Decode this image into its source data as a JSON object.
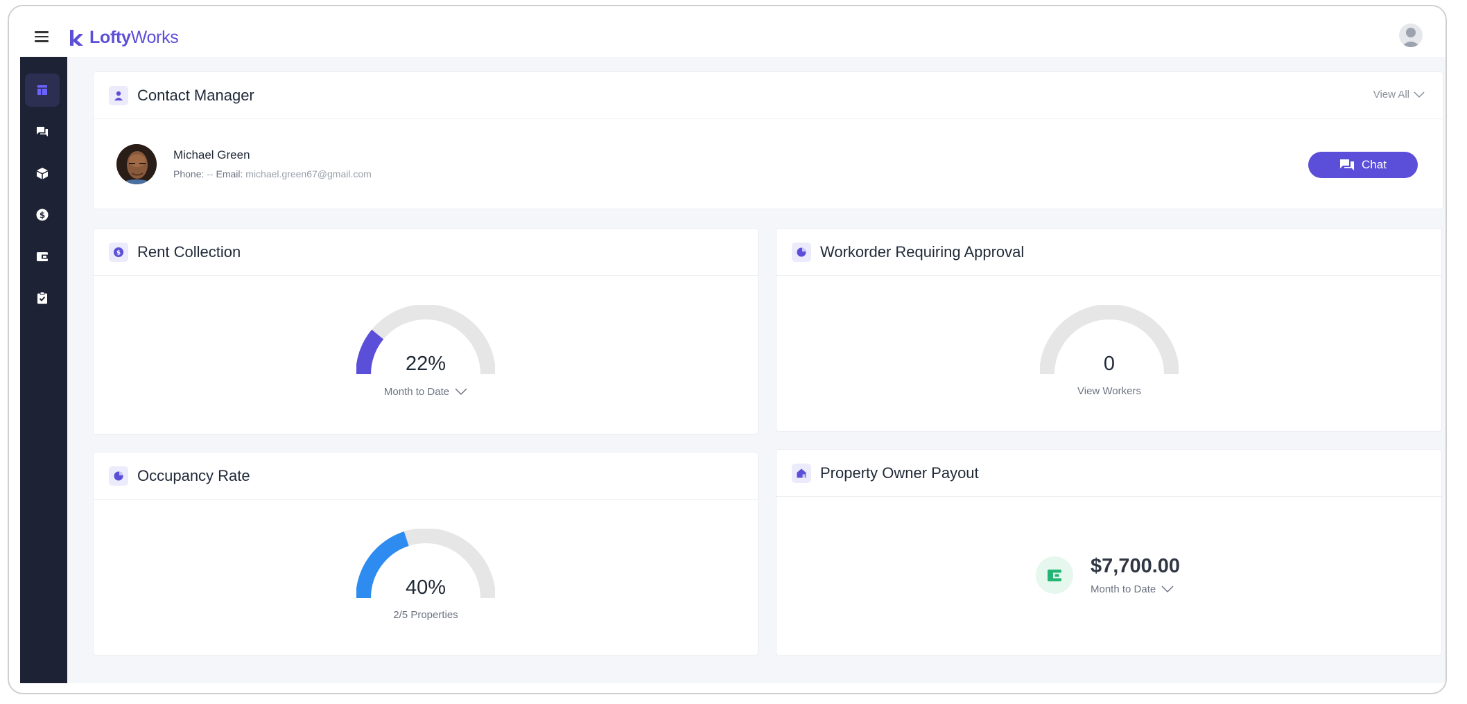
{
  "app": {
    "logo_bold": "Lofty",
    "logo_light": "Works"
  },
  "sidebar": {
    "items": [
      {
        "icon": "dashboard-icon",
        "active": true
      },
      {
        "icon": "chat-icon",
        "active": false
      },
      {
        "icon": "box-icon",
        "active": false
      },
      {
        "icon": "dollar-icon",
        "active": false
      },
      {
        "icon": "wallet-icon",
        "active": false
      },
      {
        "icon": "clipboard-check-icon",
        "active": false
      }
    ]
  },
  "contact_manager": {
    "title": "Contact Manager",
    "view_all": "View All",
    "name": "Michael Green",
    "phone_label": "Phone:",
    "phone_value": "--",
    "email_label": "Email:",
    "email_value": "michael.green67@gmail.com",
    "chat_label": "Chat"
  },
  "rent_collection": {
    "title": "Rent Collection",
    "value": "22%",
    "percent": 22,
    "period": "Month to Date",
    "color": "#5b4ed8"
  },
  "workorder": {
    "title": "Workorder Requiring Approval",
    "value": "0",
    "percent": 0,
    "link": "View Workers"
  },
  "occupancy": {
    "title": "Occupancy Rate",
    "value": "40%",
    "percent": 40,
    "sub": "2/5 Properties",
    "color": "#2e8cf0"
  },
  "payout": {
    "title": "Property Owner Payout",
    "amount": "$7,700.00",
    "period": "Month to Date",
    "color": "#22b573"
  },
  "colors": {
    "accent": "#5b4ed8",
    "sidebar_bg": "#1e2235",
    "gauge_track": "#e6e6e6"
  }
}
